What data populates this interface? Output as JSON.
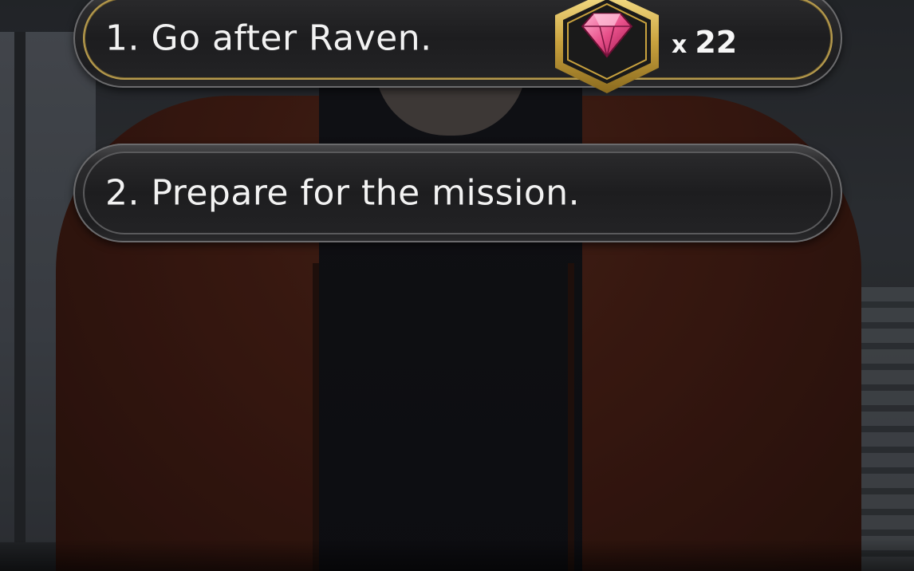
{
  "choices": [
    {
      "number": "1.",
      "text": "Go after Raven.",
      "label": "1. Go after Raven.",
      "premium": true,
      "cost": {
        "icon": "gem-icon",
        "multiplier": "x",
        "amount": "22"
      }
    },
    {
      "number": "2.",
      "text": "Prepare for the mission.",
      "label": "2. Prepare for the mission.",
      "premium": false
    }
  ],
  "colors": {
    "premium_border": "#b59a4e",
    "gem": "#e8508a",
    "button_fill": "#1d1d1f",
    "text": "#f2f2f2"
  }
}
